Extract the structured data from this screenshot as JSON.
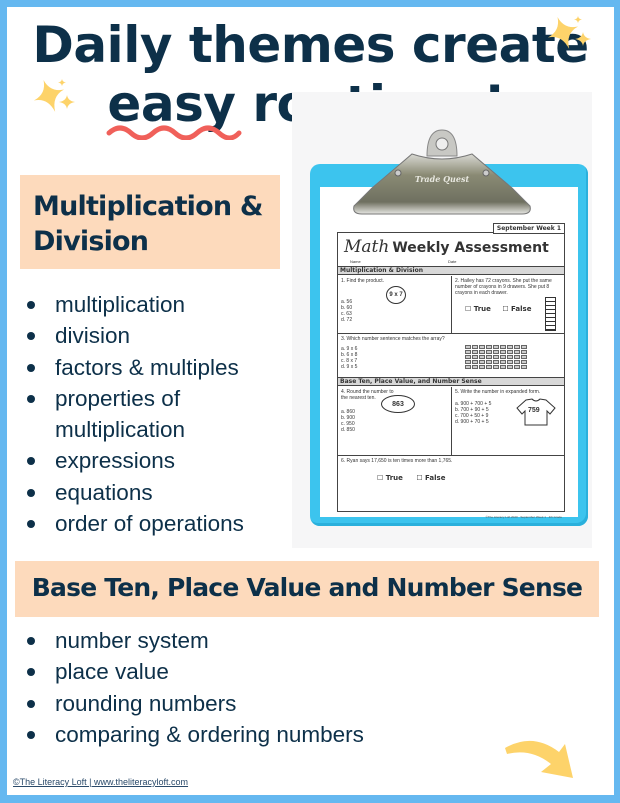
{
  "header": {
    "title_line1": "Daily themes create",
    "title_line2": "easy routines!",
    "underlined_word": "easy"
  },
  "sections": [
    {
      "heading": "Multiplication & Division",
      "heading_line1": "Multiplication &",
      "heading_line2": "Division",
      "items": [
        "multiplication",
        "division",
        "factors & multiples",
        "properties of",
        "multiplication",
        "expressions",
        "equations",
        "order of operations"
      ]
    },
    {
      "heading": "Base Ten, Place Value and Number Sense",
      "items": [
        "number system",
        "place value",
        "rounding numbers",
        "comparing & ordering numbers"
      ]
    }
  ],
  "worksheet": {
    "clip_brand": "Trade Quest",
    "week_tag": "September Week 1",
    "title_script": "Math",
    "title": "Weekly Assessment",
    "name_label": "Name",
    "date_label": "Date",
    "section1": "Multiplication & Division",
    "q1": {
      "text": "1.  Find the product.",
      "expr": "9 x 7",
      "options": [
        "a.  56",
        "b.  60",
        "c.  63",
        "d.  72"
      ]
    },
    "q2": {
      "text": "2.  Hailey has 72 crayons. She put the same number of crayons in 9 drawers. She put 8 crayons in each drawer.",
      "true_label": "True",
      "false_label": "False"
    },
    "q3": {
      "text": "3.  Which number sentence matches the array?",
      "options": [
        "a.  9 x 6",
        "b.  6 x 8",
        "c.  8 x 7",
        "d.  9 x 5"
      ]
    },
    "section2": "Base Ten, Place Value, and Number Sense",
    "q4": {
      "text": "4.  Round the number to the nearest ten.",
      "number": "863",
      "options": [
        "a.  860",
        "b.  900",
        "c.  950",
        "d.  850"
      ]
    },
    "q5": {
      "text": "5.  Write the number in expanded form.",
      "number": "759",
      "options": [
        "a.  900 + 700 + 5",
        "b.  700 + 90 + 5",
        "c.  700 + 50 + 9",
        "d.  900 + 70 + 5"
      ]
    },
    "q6": {
      "text": "6.  Ryan says 17,650 is ten times more than 1,765.",
      "true_label": "True",
      "false_label": "False"
    },
    "footer": "©The Literacy Loft 2020 · September Week 1 · 4th Grade"
  },
  "footer": {
    "credit": "©The Literacy Loft  |  www.theliteracyloft.com"
  },
  "colors": {
    "border": "#65b8f0",
    "navy": "#0d3049",
    "peach": "#fddabc",
    "squiggle": "#f0605a",
    "sparkle": "#fdd36a",
    "clipboard": "#3cc4ee"
  }
}
